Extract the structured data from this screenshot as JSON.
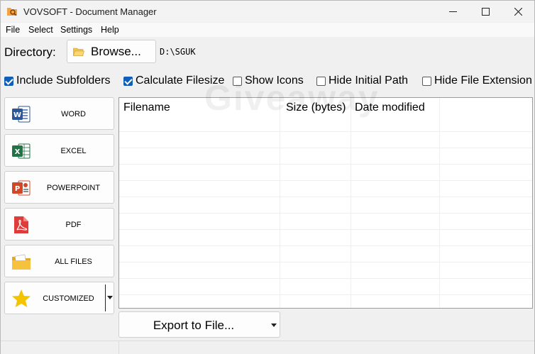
{
  "window": {
    "title": "VOVSOFT - Document Manager"
  },
  "menu": [
    "File",
    "Select",
    "Settings",
    "Help"
  ],
  "directory": {
    "label": "Directory:",
    "browse_label": "Browse...",
    "path": "D:\\SGUK"
  },
  "options": [
    {
      "label": "Include Subfolders",
      "checked": true
    },
    {
      "label": "Calculate Filesize",
      "checked": true
    },
    {
      "label": "Show Icons",
      "checked": false
    },
    {
      "label": "Hide Initial Path",
      "checked": false
    },
    {
      "label": "Hide File Extension",
      "checked": false
    }
  ],
  "watermark": "Giveaway",
  "categories": [
    {
      "label": "WORD",
      "icon": "word-icon"
    },
    {
      "label": "EXCEL",
      "icon": "excel-icon"
    },
    {
      "label": "POWERPOINT",
      "icon": "powerpoint-icon"
    },
    {
      "label": "PDF",
      "icon": "pdf-icon"
    },
    {
      "label": "ALL FILES",
      "icon": "folder-icon"
    },
    {
      "label": "CUSTOMIZED",
      "icon": "star-icon"
    }
  ],
  "filelist": {
    "columns": [
      "Filename",
      "Size (bytes)",
      "Date modified"
    ],
    "rows": []
  },
  "export": {
    "label": "Export to File..."
  },
  "colors": {
    "accent": "#0f5fb8",
    "word": "#2b579a",
    "excel": "#217346",
    "powerpoint": "#d24726",
    "pdf": "#e03b3b",
    "folder": "#f6c23e",
    "star": "#f5c400"
  }
}
